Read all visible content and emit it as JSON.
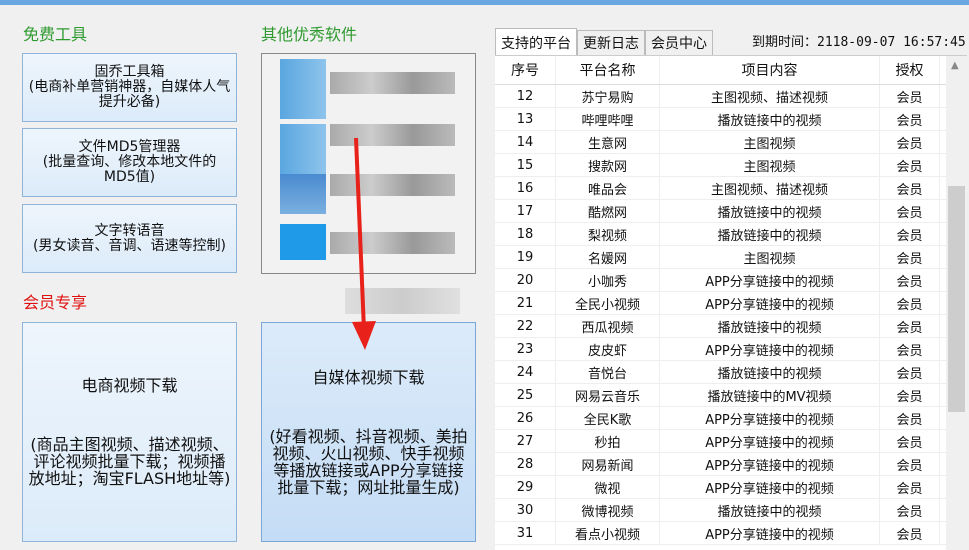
{
  "free_tools": {
    "title": "免费工具",
    "buttons": [
      {
        "title": "固乔工具箱",
        "desc": "(电商补单营销神器，自媒体人气提升必备)"
      },
      {
        "title": "文件MD5管理器",
        "desc": "(批量查询、修改本地文件的MD5值)"
      },
      {
        "title": "文字转语音",
        "desc": "(男女读音、音调、语速等控制)"
      }
    ]
  },
  "other_software": {
    "title": "其他优秀软件"
  },
  "member": {
    "title": "会员专享",
    "buttons": [
      {
        "title": "电商视频下载",
        "desc": "(商品主图视频、描述视频、评论视频批量下载；视频播放地址；淘宝FLASH地址等)"
      },
      {
        "title": "自媒体视频下载",
        "desc": "(好看视频、抖音视频、美拍视频、火山视频、快手视频等播放链接或APP分享链接批量下载；网址批量生成)"
      }
    ]
  },
  "tabs": [
    "支持的平台",
    "更新日志",
    "会员中心"
  ],
  "expire": "到期时间：2118-09-07 16:57:45",
  "table": {
    "headers": [
      "序号",
      "平台名称",
      "项目内容",
      "授权"
    ],
    "rows": [
      [
        "12",
        "苏宁易购",
        "主图视频、描述视频",
        "会员"
      ],
      [
        "13",
        "哔哩哔哩",
        "播放链接中的视频",
        "会员"
      ],
      [
        "14",
        "生意网",
        "主图视频",
        "会员"
      ],
      [
        "15",
        "搜款网",
        "主图视频",
        "会员"
      ],
      [
        "16",
        "唯品会",
        "主图视频、描述视频",
        "会员"
      ],
      [
        "17",
        "酷燃网",
        "播放链接中的视频",
        "会员"
      ],
      [
        "18",
        "梨视频",
        "播放链接中的视频",
        "会员"
      ],
      [
        "19",
        "名媛网",
        "主图视频",
        "会员"
      ],
      [
        "20",
        "小咖秀",
        "APP分享链接中的视频",
        "会员"
      ],
      [
        "21",
        "全民小视频",
        "APP分享链接中的视频",
        "会员"
      ],
      [
        "22",
        "西瓜视频",
        "播放链接中的视频",
        "会员"
      ],
      [
        "23",
        "皮皮虾",
        "APP分享链接中的视频",
        "会员"
      ],
      [
        "24",
        "音悦台",
        "播放链接中的视频",
        "会员"
      ],
      [
        "25",
        "网易云音乐",
        "播放链接中的MV视频",
        "会员"
      ],
      [
        "26",
        "全民K歌",
        "APP分享链接中的视频",
        "会员"
      ],
      [
        "27",
        "秒拍",
        "APP分享链接中的视频",
        "会员"
      ],
      [
        "28",
        "网易新闻",
        "APP分享链接中的视频",
        "会员"
      ],
      [
        "29",
        "微视",
        "APP分享链接中的视频",
        "会员"
      ],
      [
        "30",
        "微博视频",
        "播放链接中的视频",
        "会员"
      ],
      [
        "31",
        "看点小视频",
        "APP分享链接中的视频",
        "会员"
      ]
    ]
  }
}
